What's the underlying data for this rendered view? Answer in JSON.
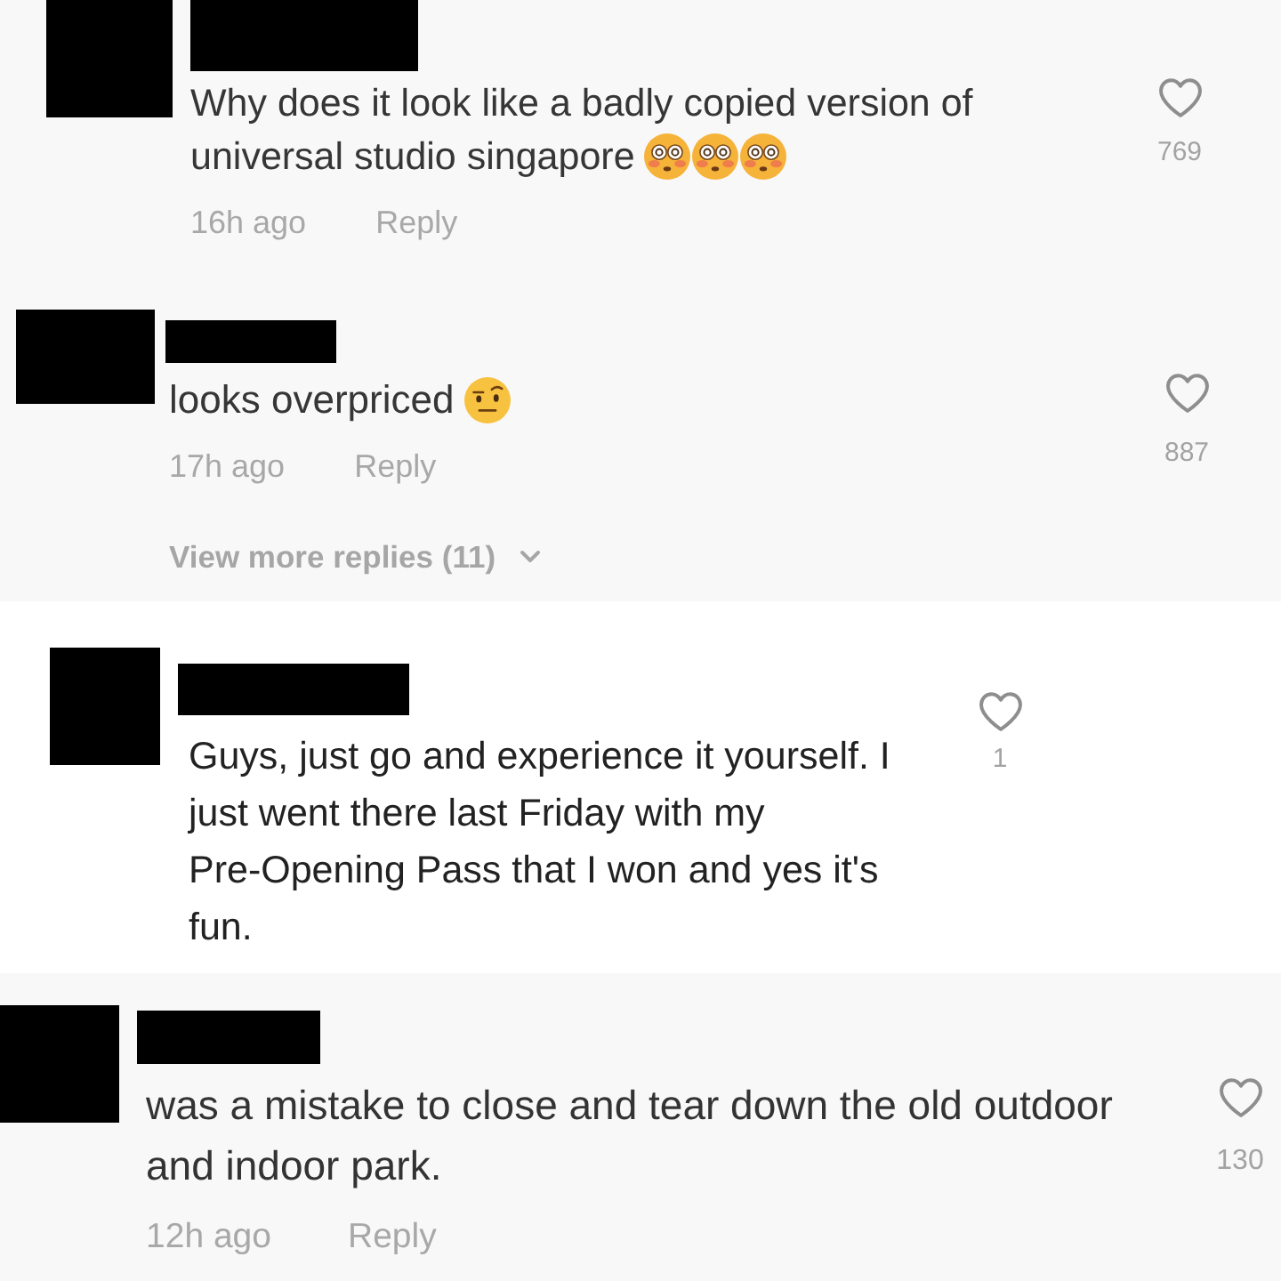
{
  "panels": [
    {
      "comments": [
        {
          "text": "Why does it look like a badly copied version of\nuniversal studio singapore",
          "emoji": [
            {
              "kind": "flushed"
            },
            {
              "kind": "flushed"
            },
            {
              "kind": "flushed"
            }
          ],
          "time": "16h ago",
          "reply_label": "Reply",
          "liked": false,
          "likes": "769"
        },
        {
          "text": "looks overpriced",
          "emoji": [
            {
              "kind": "raised-eyebrow"
            }
          ],
          "time": "17h ago",
          "reply_label": "Reply",
          "liked": false,
          "likes": "887",
          "view_more": "View more replies (11)"
        }
      ]
    },
    {
      "comments": [
        {
          "text": "Guys, just go and experience it yourself. I\njust went there last Friday with my\nPre-Opening Pass that I won and yes it's\nfun.",
          "liked": false,
          "likes": "1"
        }
      ]
    },
    {
      "comments": [
        {
          "text": "was a mistake to close and tear down the old outdoor\nand indoor park.",
          "time": "12h ago",
          "reply_label": "Reply",
          "liked": false,
          "likes": "130"
        }
      ]
    }
  ]
}
